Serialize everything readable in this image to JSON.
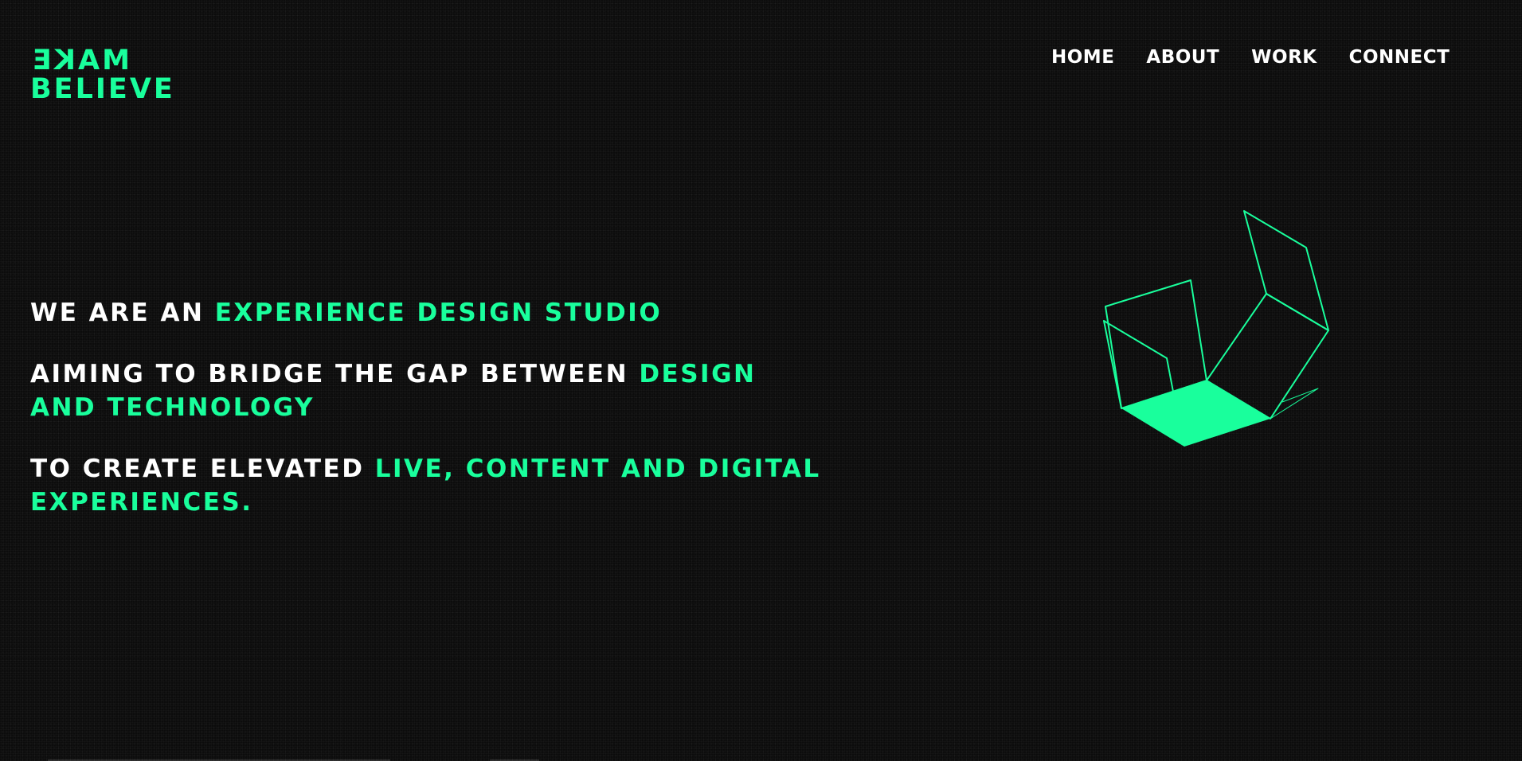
{
  "brand": {
    "line1_mirrored": "MAKE",
    "line2": "BELIEVE",
    "accent_color": "#19ff9c"
  },
  "nav": {
    "items": [
      {
        "label": "HOME"
      },
      {
        "label": "ABOUT"
      },
      {
        "label": "WORK"
      },
      {
        "label": "CONNECT"
      }
    ]
  },
  "hero": {
    "line1_white": "WE ARE AN ",
    "line1_accent": "EXPERIENCE DESIGN STUDIO",
    "line2_white": "AIMING TO BRIDGE THE GAP BETWEEN ",
    "line2_accent": "DESIGN AND TECHNOLOGY",
    "line3_white": "TO CREATE ELEVATED ",
    "line3_accent": "LIVE, CONTENT AND DIGITAL EXPERIENCES."
  },
  "graphic": {
    "icon": "unfolded-cube-icon",
    "color": "#19ff9c"
  },
  "colors": {
    "background": "#0c0c0c",
    "text": "#ffffff",
    "accent": "#19ff9c"
  }
}
